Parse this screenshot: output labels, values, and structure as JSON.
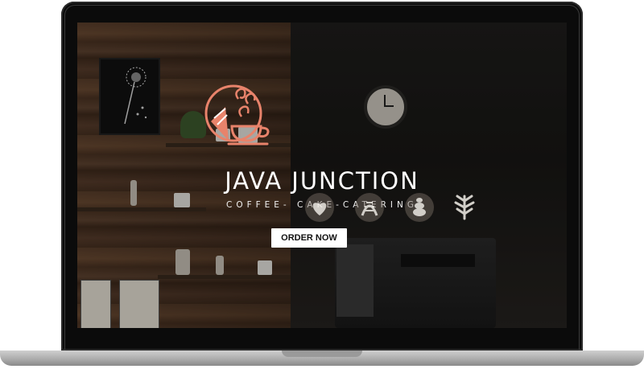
{
  "brand": {
    "title": "JAVA JUNCTION",
    "subtitle": "COFFEE- CAKE-CATERING",
    "accent_color": "#e8836b"
  },
  "cta": {
    "order_label": "ORDER NOW"
  },
  "icons": {
    "logo": "coffee-cake-logo-icon",
    "latte_art": [
      "latte-art-heart-icon",
      "latte-art-rosetta-icon",
      "latte-art-tulip-icon",
      "latte-art-leaf-icon"
    ]
  }
}
